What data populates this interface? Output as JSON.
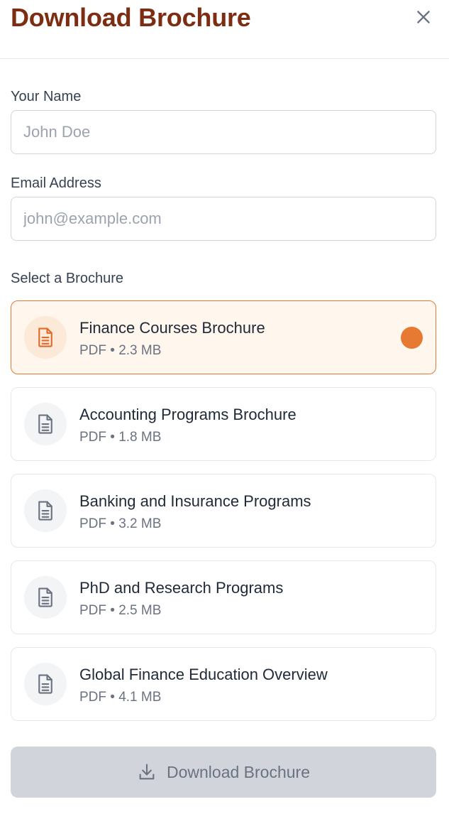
{
  "dialog": {
    "title": "Download Brochure",
    "close_icon": "close-icon"
  },
  "form": {
    "name": {
      "label": "Your Name",
      "placeholder": "John Doe",
      "value": ""
    },
    "email": {
      "label": "Email Address",
      "placeholder": "john@example.com",
      "value": ""
    },
    "brochure_section_label": "Select a Brochure"
  },
  "brochures": [
    {
      "title": "Finance Courses Brochure",
      "meta": "PDF • 2.3 MB",
      "selected": true,
      "icon": "document-icon"
    },
    {
      "title": "Accounting Programs Brochure",
      "meta": "PDF • 1.8 MB",
      "selected": false,
      "icon": "document-icon"
    },
    {
      "title": "Banking and Insurance Programs",
      "meta": "PDF • 3.2 MB",
      "selected": false,
      "icon": "document-icon"
    },
    {
      "title": "PhD and Research Programs",
      "meta": "PDF • 2.5 MB",
      "selected": false,
      "icon": "document-icon"
    },
    {
      "title": "Global Finance Education Overview",
      "meta": "PDF • 4.1 MB",
      "selected": false,
      "icon": "document-icon"
    }
  ],
  "download_button": {
    "label": "Download Brochure",
    "icon": "download-icon",
    "disabled": true
  },
  "colors": {
    "title": "#7c2d12",
    "accent": "#e67a33",
    "selected_bg": "#fff7ed",
    "disabled_button": "#d1d5db"
  }
}
